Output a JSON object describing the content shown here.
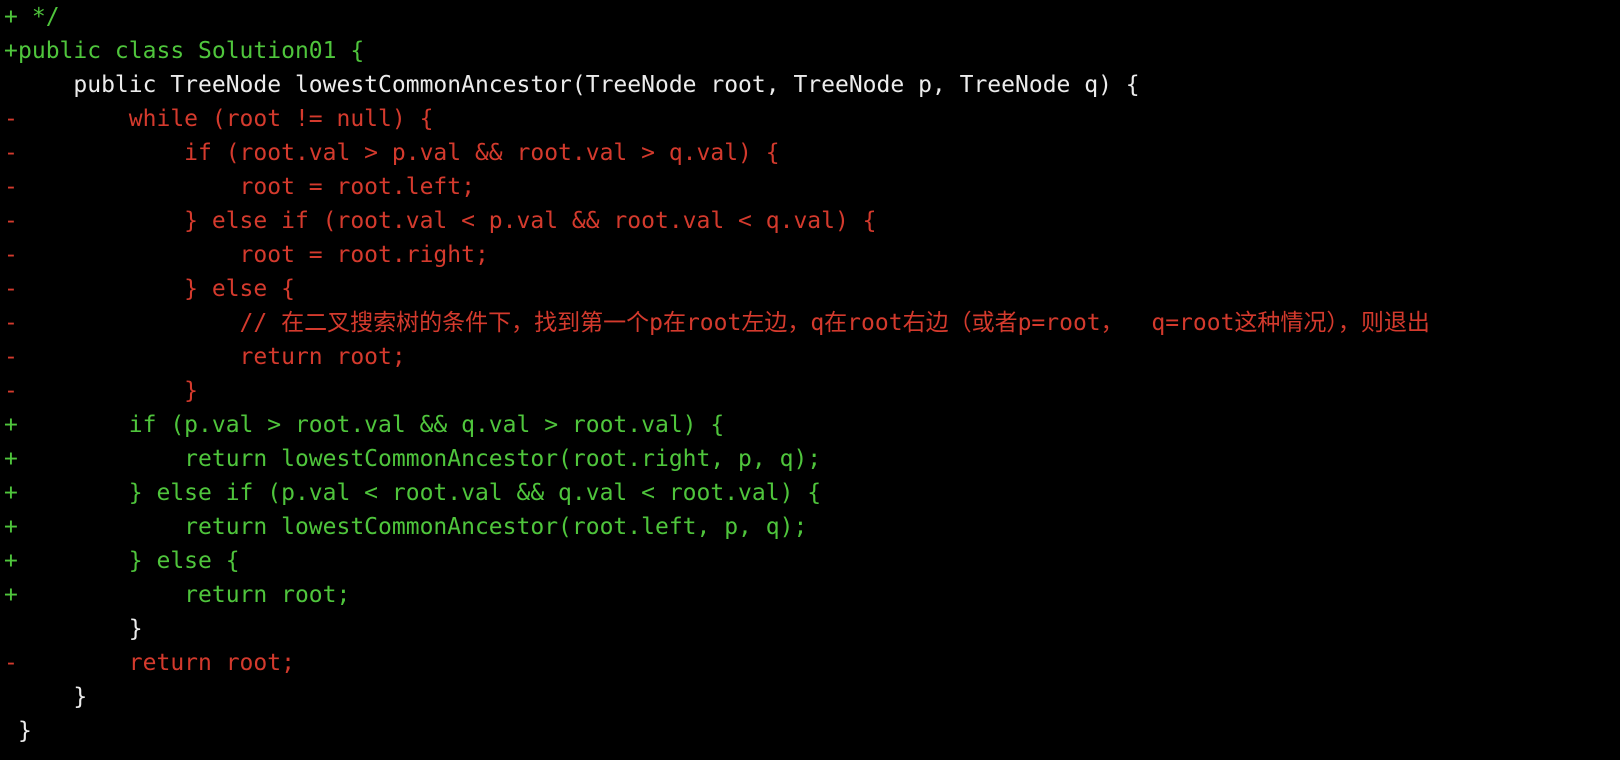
{
  "diff_lines": [
    {
      "type": "added",
      "marker": "+",
      "text": " */"
    },
    {
      "type": "added",
      "marker": "+",
      "text": "public class Solution01 {"
    },
    {
      "type": "context",
      "marker": " ",
      "text": "    public TreeNode lowestCommonAncestor(TreeNode root, TreeNode p, TreeNode q) {"
    },
    {
      "type": "removed",
      "marker": "-",
      "text": "        while (root != null) {"
    },
    {
      "type": "removed",
      "marker": "-",
      "text": "            if (root.val > p.val && root.val > q.val) {"
    },
    {
      "type": "removed",
      "marker": "-",
      "text": "                root = root.left;"
    },
    {
      "type": "removed",
      "marker": "-",
      "text": "            } else if (root.val < p.val && root.val < q.val) {"
    },
    {
      "type": "removed",
      "marker": "-",
      "text": "                root = root.right;"
    },
    {
      "type": "removed",
      "marker": "-",
      "text": "            } else {"
    },
    {
      "type": "removed",
      "marker": "-",
      "text": "                // 在二叉搜索树的条件下，找到第一个p在root左边，q在root右边（或者p=root，  q=root这种情况），则退出"
    },
    {
      "type": "removed",
      "marker": "-",
      "text": "                return root;"
    },
    {
      "type": "removed",
      "marker": "-",
      "text": "            }"
    },
    {
      "type": "added",
      "marker": "+",
      "text": "        if (p.val > root.val && q.val > root.val) {"
    },
    {
      "type": "added",
      "marker": "+",
      "text": "            return lowestCommonAncestor(root.right, p, q);"
    },
    {
      "type": "added",
      "marker": "+",
      "text": "        } else if (p.val < root.val && q.val < root.val) {"
    },
    {
      "type": "added",
      "marker": "+",
      "text": "            return lowestCommonAncestor(root.left, p, q);"
    },
    {
      "type": "added",
      "marker": "+",
      "text": "        } else {"
    },
    {
      "type": "added",
      "marker": "+",
      "text": "            return root;"
    },
    {
      "type": "context",
      "marker": " ",
      "text": "        }"
    },
    {
      "type": "removed",
      "marker": "-",
      "text": "        return root;"
    },
    {
      "type": "context",
      "marker": " ",
      "text": "    }"
    },
    {
      "type": "context",
      "marker": " ",
      "text": "}"
    }
  ],
  "colors": {
    "background": "#000000",
    "added": "#4fc53c",
    "removed": "#d43a2d",
    "context": "#ececec"
  }
}
